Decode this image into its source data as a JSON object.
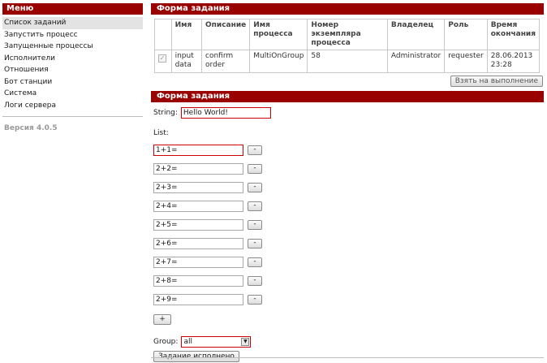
{
  "sidebar": {
    "title": "Меню",
    "items": [
      {
        "label": "Список заданий",
        "active": true
      },
      {
        "label": "Запустить процесс"
      },
      {
        "label": "Запущенные процессы"
      },
      {
        "label": "Исполнители"
      },
      {
        "label": "Отношения"
      },
      {
        "label": "Бот станции"
      },
      {
        "label": "Система"
      },
      {
        "label": "Логи сервера"
      }
    ],
    "version": "Версия 4.0.5"
  },
  "tasks": {
    "title": "Форма задания",
    "columns": [
      "Имя",
      "Описание",
      "Имя процесса",
      "Номер экземпляра процесса",
      "Владелец",
      "Роль",
      "Время окончания"
    ],
    "rows": [
      {
        "name": "input data",
        "description": "confirm order",
        "process": "MultiOnGroup",
        "instance": "58",
        "owner": "Administrator",
        "role": "requester",
        "end_time": "28.06.2013 23:28"
      }
    ],
    "take_button": "Взять на выполнение"
  },
  "form": {
    "title": "Форма задания",
    "string_label": "String:",
    "string_value": "Hello World!",
    "list_label": "List:",
    "list_items": [
      "1+1=",
      "2+2=",
      "2+3=",
      "2+4=",
      "2+5=",
      "2+6=",
      "2+7=",
      "2+8=",
      "2+9="
    ],
    "remove_label": "-",
    "add_label": "+",
    "group_label": "Group:",
    "group_value": "all",
    "submit_label": "Задание исполнено"
  },
  "icons": {
    "checkbox": "checkmark-icon",
    "dropdown": "triangle-down-icon"
  },
  "colors": {
    "accent": "#990000",
    "error_border": "#cc0000"
  }
}
